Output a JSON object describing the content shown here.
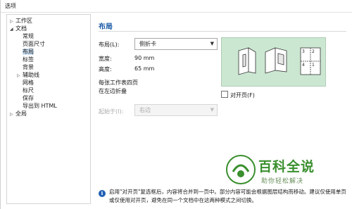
{
  "window": {
    "title": "选项"
  },
  "tree": {
    "items": [
      {
        "label": "工作区",
        "arrow": "▷",
        "level": 0
      },
      {
        "label": "文档",
        "arrow": "◢",
        "level": 0
      },
      {
        "label": "常规",
        "arrow": "",
        "level": 1
      },
      {
        "label": "页面尺寸",
        "arrow": "",
        "level": 1
      },
      {
        "label": "布局",
        "arrow": "",
        "level": 1,
        "selected": true
      },
      {
        "label": "标签",
        "arrow": "",
        "level": 1
      },
      {
        "label": "背景",
        "arrow": "",
        "level": 1
      },
      {
        "label": "辅助线",
        "arrow": "▷",
        "level": 1
      },
      {
        "label": "网格",
        "arrow": "",
        "level": 1
      },
      {
        "label": "标尺",
        "arrow": "",
        "level": 1
      },
      {
        "label": "保存",
        "arrow": "",
        "level": 1
      },
      {
        "label": "导出到 HTML",
        "arrow": "",
        "level": 1
      },
      {
        "label": "全局",
        "arrow": "▷",
        "level": 0
      }
    ]
  },
  "layout_panel": {
    "section_title": "布局",
    "layout_label": "布局(L):",
    "layout_value": "侧折卡",
    "width_label": "宽度:",
    "width_value": "90 mm",
    "height_label": "高度:",
    "height_value": "65 mm",
    "desc_line1": "每张工作表四页",
    "desc_line2": "在左边折叠",
    "facing_pages_label": "对开页(F)",
    "facing_pages_checked": false,
    "start_on_label": "起始于(I):",
    "start_on_value": "右边"
  },
  "info": {
    "text": "启用\"对开页\"复选框后，内容将合并到一页中。部分内容可能会根据图层结构而移动。建议仅使用单页或仅使用对开页，避免在同一个文档中在这两种模式之间切换。"
  },
  "watermark": {
    "title": "百科全说",
    "subtitle": "助你轻松解决"
  },
  "colors": {
    "accent": "#1e5da8",
    "preview_bg": "#cbe7d2",
    "selection": "#cfe3f6",
    "watermark_green": "#3a8f2e"
  }
}
